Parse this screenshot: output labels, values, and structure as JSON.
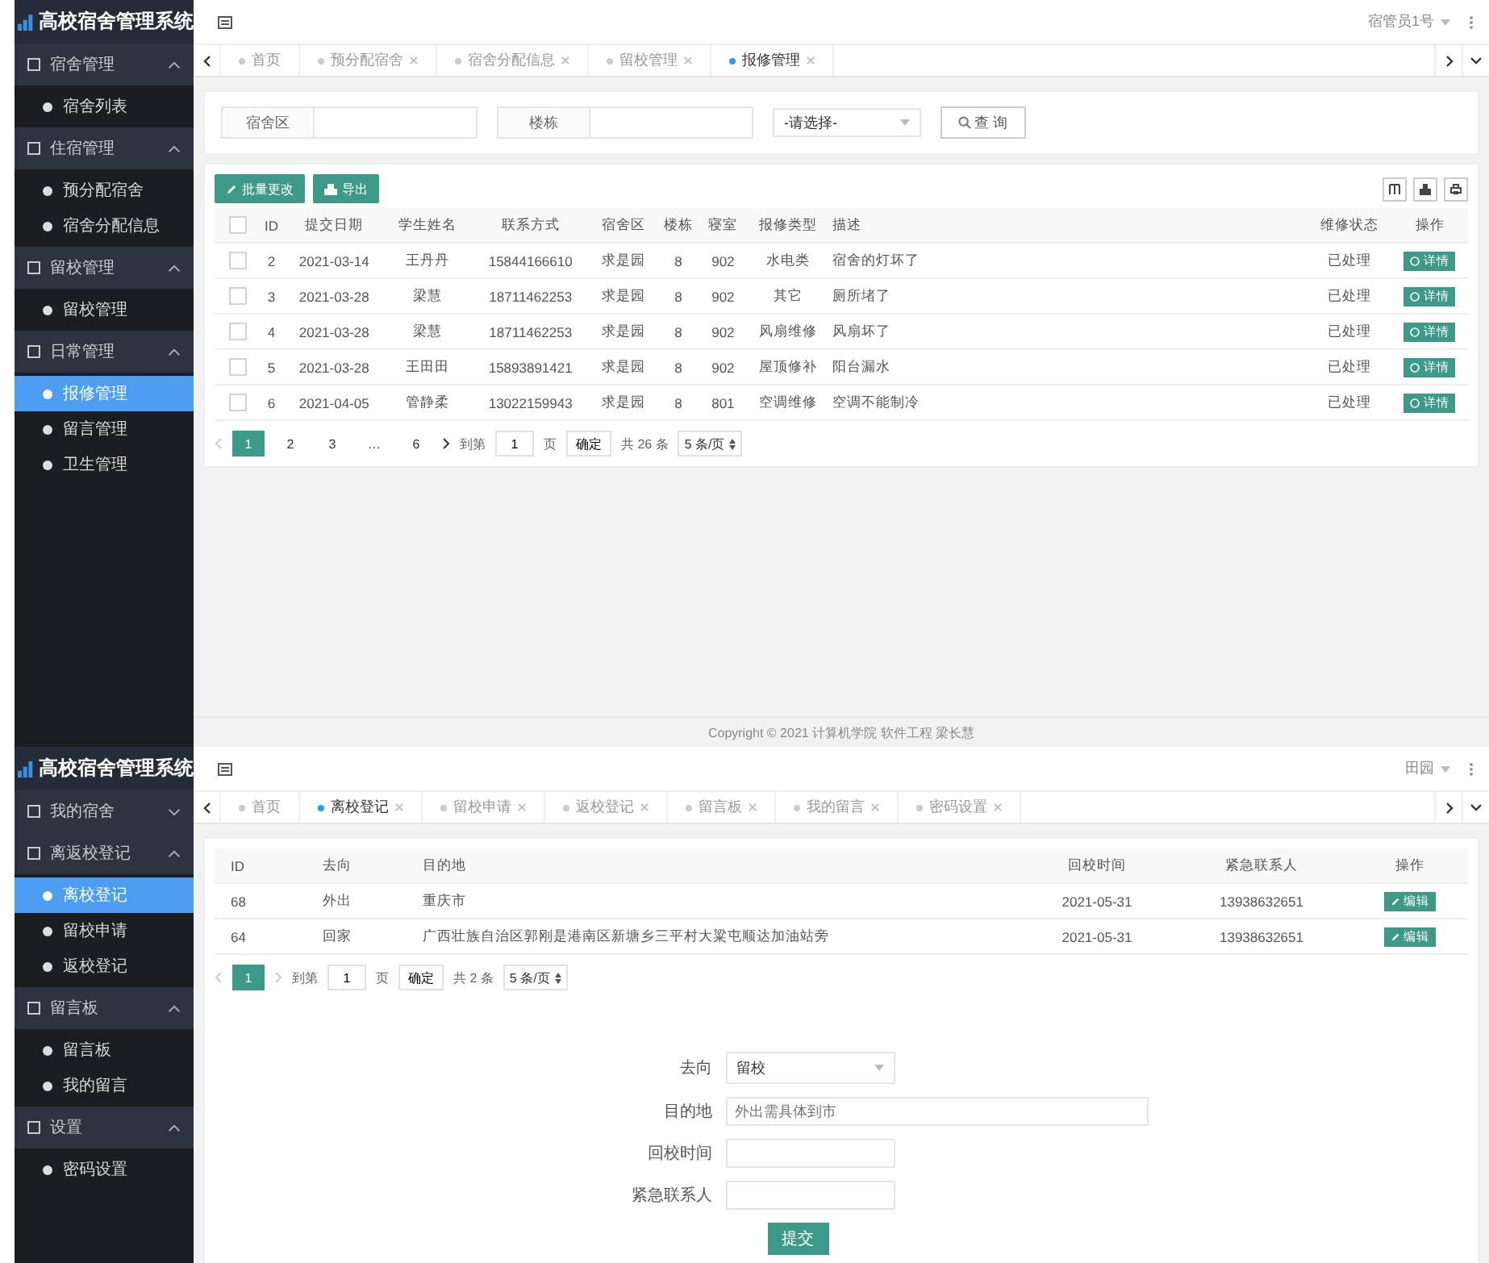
{
  "screens": [
    {
      "kind": "repair_list",
      "app_title": "高校宿舍管理系统",
      "user": "宿管员1号",
      "sidebar": [
        {
          "label": "宿舍管理",
          "expanded": true,
          "children": [
            {
              "label": "宿舍列表",
              "selected": false
            }
          ]
        },
        {
          "label": "住宿管理",
          "expanded": true,
          "children": [
            {
              "label": "预分配宿舍",
              "selected": false
            },
            {
              "label": "宿舍分配信息",
              "selected": false
            }
          ]
        },
        {
          "label": "留校管理",
          "expanded": true,
          "children": [
            {
              "label": "留校管理",
              "selected": false
            }
          ]
        },
        {
          "label": "日常管理",
          "expanded": true,
          "children": [
            {
              "label": "报修管理",
              "selected": true
            },
            {
              "label": "留言管理",
              "selected": false
            },
            {
              "label": "卫生管理",
              "selected": false
            }
          ]
        }
      ],
      "tabs": [
        {
          "label": "首页",
          "selected": false,
          "closable": false
        },
        {
          "label": "预分配宿舍",
          "selected": false,
          "closable": true
        },
        {
          "label": "宿舍分配信息",
          "selected": false,
          "closable": true
        },
        {
          "label": "留校管理",
          "selected": false,
          "closable": true
        },
        {
          "label": "报修管理",
          "selected": true,
          "closable": true
        }
      ],
      "search": {
        "fields": [
          {
            "label": "宿舍区"
          },
          {
            "label": "楼栋"
          }
        ],
        "select": "-请选择-",
        "button": "查 询"
      },
      "toolbar": [
        "批量更改",
        "导出"
      ],
      "table": {
        "all_checked": false,
        "columns": [
          "ID",
          "提交日期",
          "学生姓名",
          "联系方式",
          "宿舍区",
          "楼栋",
          "寝室",
          "报修类型",
          "描述",
          "维修状态",
          "操作"
        ],
        "rows": [
          {
            "checked": false,
            "cells": [
              "2",
              "2021-03-14",
              "王丹丹",
              "15844166610",
              "求是园",
              "8",
              "902",
              "水电类",
              "宿舍的灯坏了",
              "已处理"
            ],
            "action": "详情"
          },
          {
            "checked": false,
            "cells": [
              "3",
              "2021-03-28",
              "梁慧",
              "18711462253",
              "求是园",
              "8",
              "902",
              "其它",
              "厕所堵了",
              "已处理"
            ],
            "action": "详情"
          },
          {
            "checked": false,
            "cells": [
              "4",
              "2021-03-28",
              "梁慧",
              "18711462253",
              "求是园",
              "8",
              "902",
              "风扇维修",
              "风扇坏了",
              "已处理"
            ],
            "action": "详情"
          },
          {
            "checked": false,
            "cells": [
              "5",
              "2021-03-28",
              "王田田",
              "15893891421",
              "求是园",
              "8",
              "902",
              "屋顶修补",
              "阳台漏水",
              "已处理"
            ],
            "action": "详情"
          },
          {
            "checked": false,
            "cells": [
              "6",
              "2021-04-05",
              "管静柔",
              "13022159943",
              "求是园",
              "8",
              "801",
              "空调维修",
              "空调不能制冷",
              "已处理"
            ],
            "action": "详情"
          }
        ]
      },
      "pagination": {
        "pages": [
          {
            "label": "1",
            "selected": true
          },
          {
            "label": "2",
            "selected": false
          },
          {
            "label": "3",
            "selected": false
          },
          {
            "label": "…",
            "selected": false
          },
          {
            "label": "6",
            "selected": false
          }
        ],
        "goto": "到第",
        "page": "1",
        "unit": "页",
        "confirm": "确定",
        "total": "共 26 条",
        "per_page": "5 条/页"
      },
      "footer": "Copyright © 2021 计算机学院 软件工程 梁长慧"
    },
    {
      "kind": "leave_register",
      "app_title": "高校宿舍管理系统",
      "user": "田园",
      "sidebar": [
        {
          "label": "我的宿舍",
          "expanded": false
        },
        {
          "label": "离返校登记",
          "expanded": true,
          "children": [
            {
              "label": "离校登记",
              "selected": true
            },
            {
              "label": "留校申请",
              "selected": false
            },
            {
              "label": "返校登记",
              "selected": false
            }
          ]
        },
        {
          "label": "留言板",
          "expanded": true,
          "children": [
            {
              "label": "留言板",
              "selected": false
            },
            {
              "label": "我的留言",
              "selected": false
            }
          ]
        },
        {
          "label": "设置",
          "expanded": true,
          "children": [
            {
              "label": "密码设置",
              "selected": false
            }
          ]
        }
      ],
      "tabs": [
        {
          "label": "首页",
          "selected": false,
          "closable": false
        },
        {
          "label": "离校登记",
          "selected": true,
          "closable": true
        },
        {
          "label": "留校申请",
          "selected": false,
          "closable": true
        },
        {
          "label": "返校登记",
          "selected": false,
          "closable": true
        },
        {
          "label": "留言板",
          "selected": false,
          "closable": true
        },
        {
          "label": "我的留言",
          "selected": false,
          "closable": true
        },
        {
          "label": "密码设置",
          "selected": false,
          "closable": true
        }
      ],
      "table": {
        "columns": [
          "ID",
          "去向",
          "目的地",
          "回校时间",
          "紧急联系人",
          "操作"
        ],
        "rows": [
          {
            "cells": [
              "68",
              "外出",
              "重庆市",
              "2021-05-31",
              "13938632651"
            ],
            "action": "编辑"
          },
          {
            "cells": [
              "64",
              "回家",
              "广西壮族自治区郭刚是港南区新塘乡三平村大粱屯顺达加油站旁",
              "2021-05-31",
              "13938632651"
            ],
            "action": "编辑"
          }
        ]
      },
      "pagination": {
        "pages": [
          {
            "label": "1",
            "selected": true
          }
        ],
        "goto": "到第",
        "page": "1",
        "unit": "页",
        "confirm": "确定",
        "total": "共 2 条",
        "per_page": "5 条/页"
      },
      "form": {
        "fields": [
          {
            "label": "去向",
            "kind": "select",
            "value": "留校"
          },
          {
            "label": "目的地",
            "kind": "long_text",
            "placeholder": "外出需具体到市"
          },
          {
            "label": "回校时间",
            "kind": "text"
          },
          {
            "label": "紧急联系人",
            "kind": "text"
          }
        ],
        "submit": "提交"
      }
    }
  ]
}
